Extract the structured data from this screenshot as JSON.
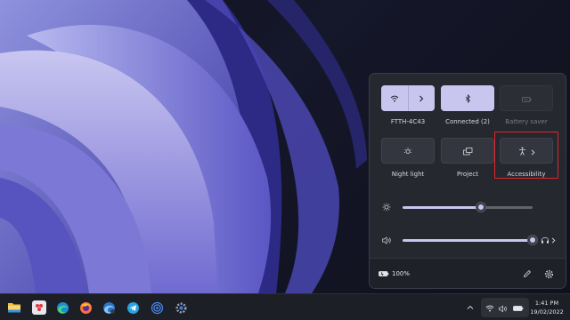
{
  "quick_settings": {
    "tiles": [
      {
        "label": "FTTH-4C43",
        "icon": "wifi-icon",
        "state": "on",
        "has_arrow": true
      },
      {
        "label": "Connected (2)",
        "icon": "bluetooth-icon",
        "state": "on",
        "has_arrow": false
      },
      {
        "label": "Battery saver",
        "icon": "battery-saver-icon",
        "state": "disabled",
        "has_arrow": false
      },
      {
        "label": "Night light",
        "icon": "night-light-icon",
        "state": "off",
        "has_arrow": false
      },
      {
        "label": "Project",
        "icon": "project-icon",
        "state": "off",
        "has_arrow": false
      },
      {
        "label": "Accessibility",
        "icon": "accessibility-icon",
        "state": "off",
        "has_arrow": true
      }
    ],
    "brightness": {
      "icon": "brightness-icon",
      "level": 0.6
    },
    "volume": {
      "icon": "speaker-icon",
      "level": 1.0,
      "output_icon": "headphones-icon"
    },
    "footer": {
      "battery_icon": "battery-icon",
      "battery_text": "100%",
      "edit_icon": "pencil-icon",
      "settings_icon": "gear-icon"
    }
  },
  "taskbar": {
    "apps": [
      "file-explorer-icon",
      "app-icon",
      "edge-icon",
      "firefox-icon",
      "edge-dev-icon",
      "telegram-icon",
      "podcast-icon",
      "settings-icon"
    ],
    "tray": [
      "wifi-icon",
      "speaker-icon",
      "battery-icon"
    ],
    "time": "1:41 PM",
    "date": "19/02/2022"
  },
  "colors": {
    "accent": "#c8c6ef",
    "highlight": "#e0252b",
    "panel": "#262830"
  }
}
